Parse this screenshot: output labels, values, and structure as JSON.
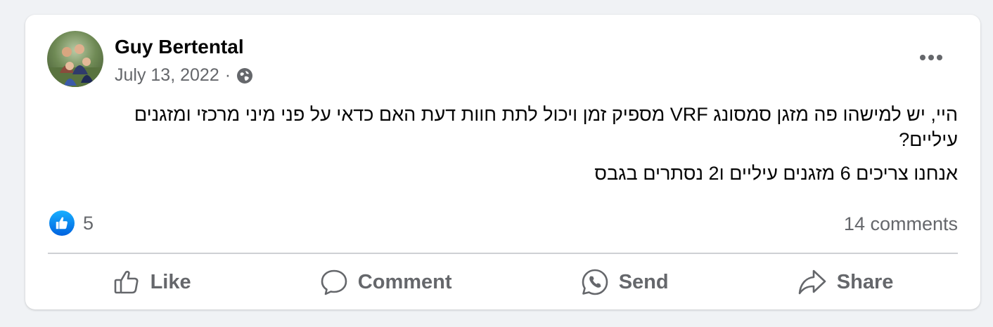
{
  "post": {
    "author": "Guy Bertental",
    "date": "July 13, 2022",
    "separator": "·",
    "paragraphs": [
      "היי, יש למישהו פה מזגן סמסונג VRF מספיק זמן ויכול לתת חוות דעת האם כדאי על פני מיני מרכזי ומזגנים עיליים?",
      "אנחנו צריכים 6 מזגנים עיליים ו2 נסתרים בגבס"
    ],
    "reaction_count": "5",
    "comments_count": "14 comments"
  },
  "actions": {
    "like": "Like",
    "comment": "Comment",
    "send": "Send",
    "share": "Share"
  },
  "icons": {
    "audience": "globe-icon",
    "more": "more-options-icon",
    "reaction": "like-reaction-icon"
  },
  "colors": {
    "background": "#f0f2f5",
    "card": "#ffffff",
    "text_primary": "#050505",
    "text_secondary": "#65676b",
    "like_blue": "#0866ff"
  }
}
